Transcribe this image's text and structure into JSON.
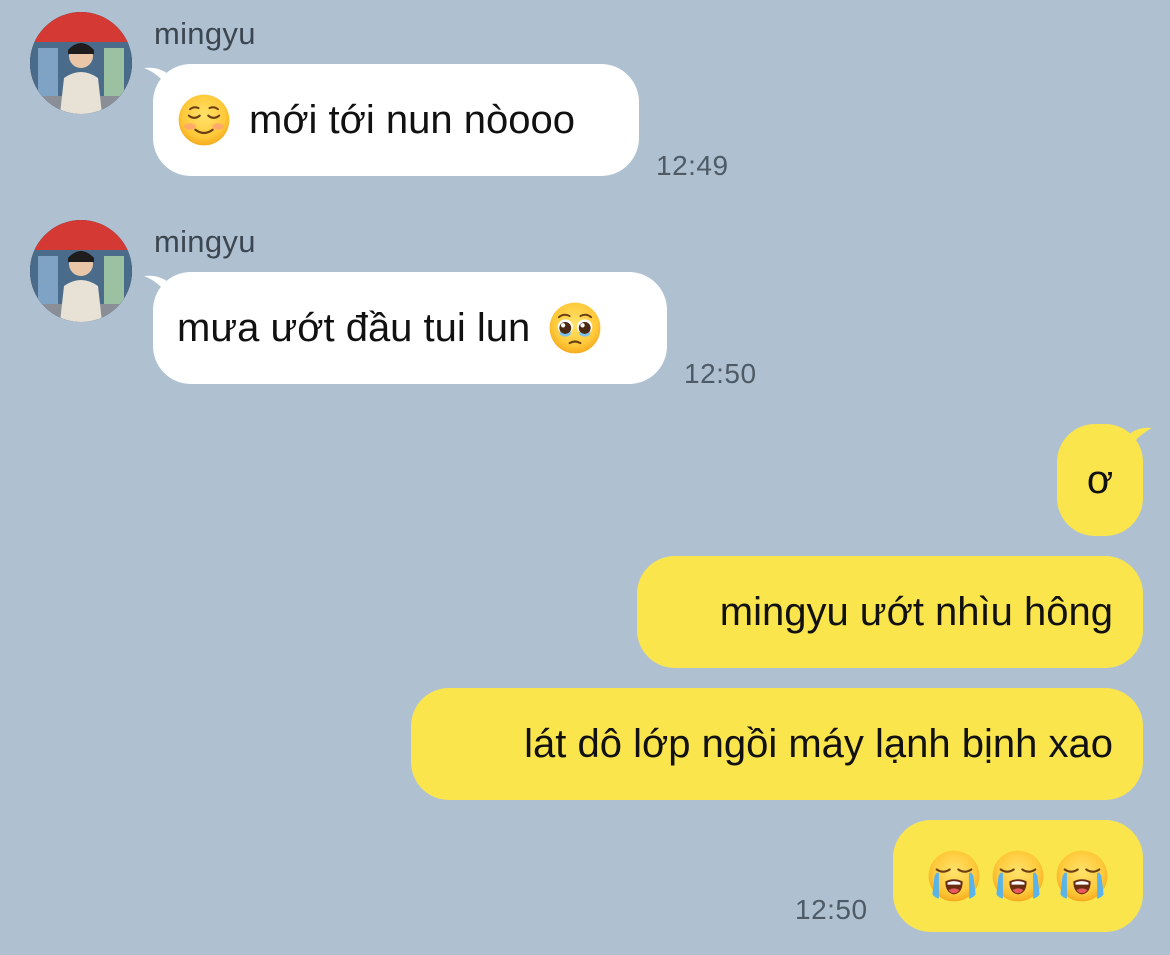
{
  "messages": [
    {
      "sender": "mingyu",
      "text": "mới tới nun nòooo",
      "emoji": "smiling-face-icon",
      "time": "12:49"
    },
    {
      "sender": "mingyu",
      "text": "mưa ướt đầu tui lun",
      "emoji": "pleading-face-icon",
      "time": "12:50"
    },
    {
      "text": "ơ"
    },
    {
      "text": "mingyu ướt nhìu hông"
    },
    {
      "text": "lát dô lớp ngồi máy lạnh bịnh xao"
    },
    {
      "emojis": [
        "loudly-crying-face-icon",
        "loudly-crying-face-icon",
        "loudly-crying-face-icon"
      ],
      "time": "12:50"
    }
  ],
  "colors": {
    "background": "#afc1d1",
    "incoming_bubble": "#ffffff",
    "outgoing_bubble": "#fae54d"
  }
}
